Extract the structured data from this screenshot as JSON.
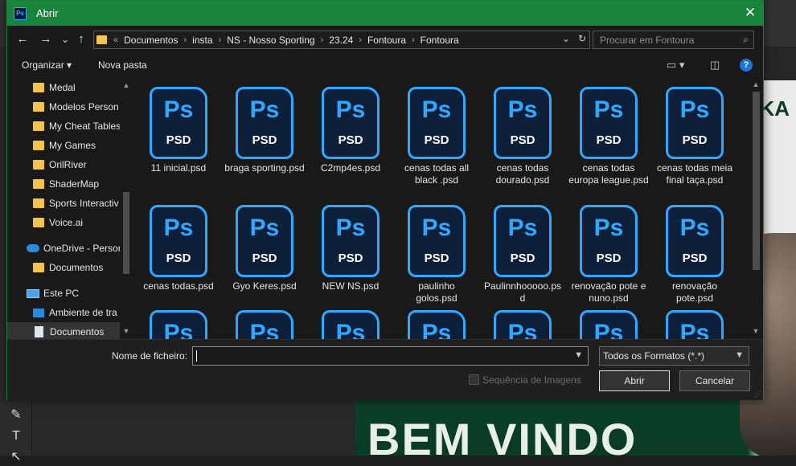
{
  "dialog": {
    "title": "Abrir",
    "app_icon_text": "Ps",
    "close_glyph": "✕"
  },
  "nav": {
    "back_glyph": "←",
    "forward_glyph": "→",
    "dropdown_glyph": "⌄",
    "up_glyph": "↑",
    "overflow": "«",
    "breadcrumbs": [
      "Documentos",
      "insta",
      "NS - Nosso Sporting",
      "23.24",
      "Fontoura",
      "Fontoura"
    ],
    "refresh_glyph": "↻",
    "search_placeholder": "Procurar em Fontoura",
    "search_glyph": "⌕"
  },
  "commands": {
    "organize": "Organizar ▾",
    "new_folder": "Nova pasta",
    "help": "?"
  },
  "sidebar": {
    "items": [
      {
        "label": "Medal",
        "icon": "folder"
      },
      {
        "label": "Modelos Person",
        "icon": "folder"
      },
      {
        "label": "My Cheat Tables",
        "icon": "folder"
      },
      {
        "label": "My Games",
        "icon": "folder"
      },
      {
        "label": "OrilRiver",
        "icon": "folder"
      },
      {
        "label": "ShaderMap",
        "icon": "folder"
      },
      {
        "label": "Sports Interactiv",
        "icon": "folder"
      },
      {
        "label": "Voice.ai",
        "icon": "folder"
      },
      {
        "label": "OneDrive - Persor",
        "icon": "cloud"
      },
      {
        "label": "Documentos",
        "icon": "folder"
      },
      {
        "label": "Este PC",
        "icon": "pc"
      },
      {
        "label": "Ambiente de tra",
        "icon": "monitor"
      },
      {
        "label": "Documentos",
        "icon": "doc"
      }
    ]
  },
  "files": [
    {
      "name": "11 inicial.psd"
    },
    {
      "name": "braga sporting.psd"
    },
    {
      "name": "C2mp4es.psd"
    },
    {
      "name": "cenas todas all black .psd"
    },
    {
      "name": "cenas todas dourado.psd"
    },
    {
      "name": "cenas todas europa league.psd"
    },
    {
      "name": "cenas todas meia final taça.psd"
    },
    {
      "name": "cenas todas.psd"
    },
    {
      "name": "Gyo Keres.psd"
    },
    {
      "name": "NEW NS.psd"
    },
    {
      "name": "paulinho golos.psd"
    },
    {
      "name": "Paulinnhooooo.psd"
    },
    {
      "name": "renovação pote e nuno.psd"
    },
    {
      "name": "renovação pote.psd"
    }
  ],
  "file_icon": {
    "letters": "Ps",
    "label": "PSD"
  },
  "bottom": {
    "filename_label": "Nome de ficheiro:",
    "filename_value": "",
    "filter_value": "Todos os Formatos (*.*)",
    "sequence_label": "Sequência de Imagens",
    "open_button": "Abrir",
    "cancel_button": "Cancelar"
  },
  "background": {
    "poster_text": "BEM VINDO",
    "poster_corner": "KA"
  },
  "colors": {
    "titlebar": "#19843c",
    "ps_blue": "#31a8ff",
    "folder_yellow": "#f4c44d"
  }
}
